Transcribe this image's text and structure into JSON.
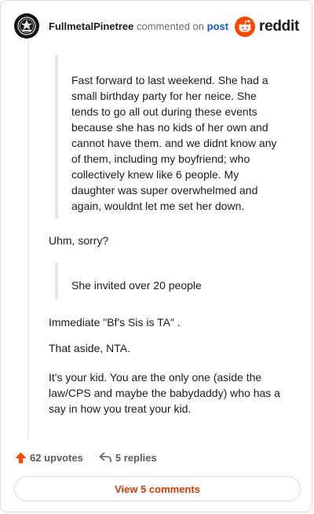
{
  "header": {
    "username": "FullmetalPinetree",
    "verb": "commented on",
    "post_link": "post",
    "brand": "reddit"
  },
  "comment": {
    "quote1": "Fast forward to last weekend. She had a small birthday party for her neice. She tends to go all out during these events because she has no kids of her own and cannot have them. and we didnt know any of them, including my boyfriend; who collectively knew like 6 people. My daughter was super overwhelmed and again, wouldnt let me set her down.",
    "p1": "Uhm, sorry?",
    "quote2": "She invited over 20 people",
    "p2": "Immediate \"Bf's Sis is TA\" .",
    "p3": "That aside, NTA.",
    "p4": "It's your kid. You are the only one (aside the law/CPS and maybe the babydaddy) who has a say in how you treat your kid."
  },
  "actions": {
    "upvotes": "62 upvotes",
    "replies": "5 replies",
    "view_comments": "View 5 comments"
  },
  "colors": {
    "accent": "#ff4500",
    "link": "#0a5bd6",
    "button_text": "#d93a00"
  }
}
